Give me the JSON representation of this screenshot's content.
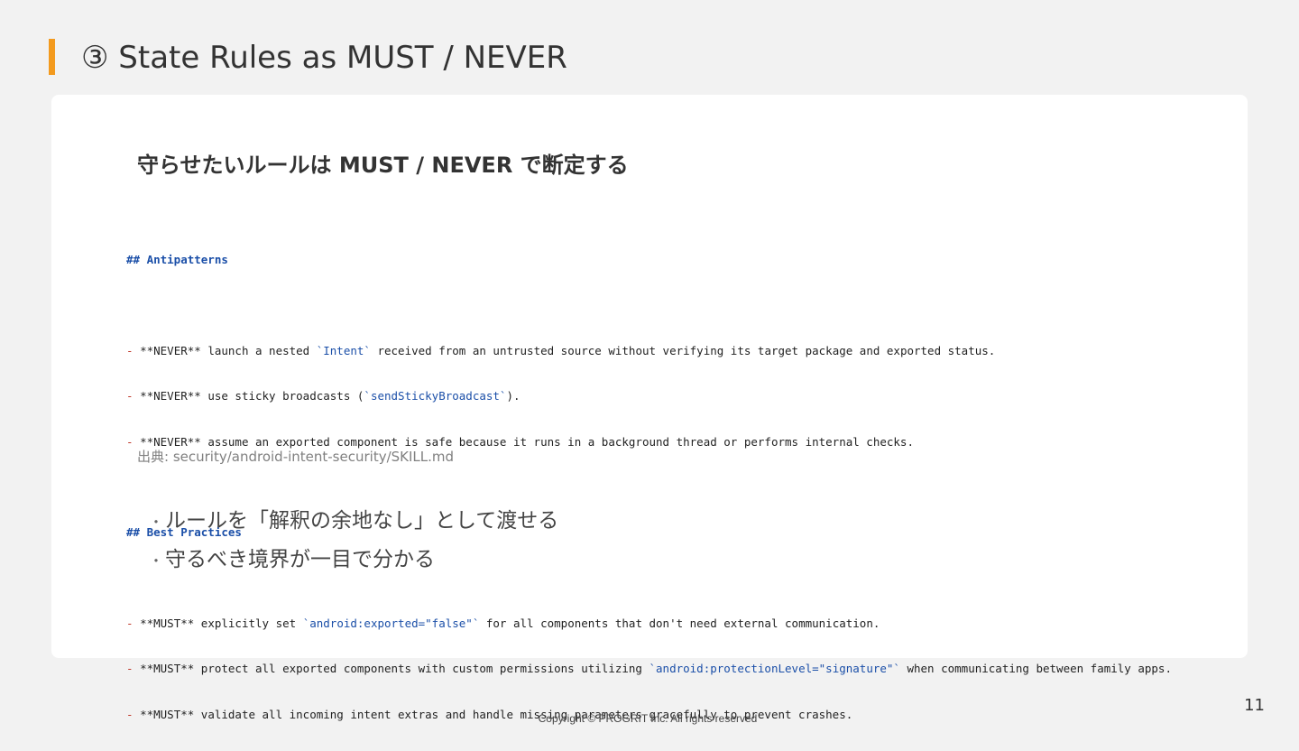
{
  "slide": {
    "title": "③ State Rules as MUST / NEVER",
    "accent_color": "#f39a1e"
  },
  "card": {
    "heading": "守らせたいルールは MUST / NEVER で断定する",
    "code": {
      "antipatterns_header": "## Antipatterns",
      "antipatterns": [
        {
          "dash": "- ",
          "pre": "**NEVER** launch a nested ",
          "code": "`Intent`",
          "post": " received from an untrusted source without verifying its target package and exported status."
        },
        {
          "dash": "- ",
          "pre": "**NEVER** use sticky broadcasts (",
          "code": "`sendStickyBroadcast`",
          "post": ")."
        },
        {
          "dash": "- ",
          "pre": "**NEVER** assume an exported component is safe because it runs in a background thread or performs internal checks.",
          "code": "",
          "post": ""
        }
      ],
      "best_practices_header": "## Best Practices",
      "best_practices": [
        {
          "dash": "- ",
          "pre": "**MUST** explicitly set ",
          "code": "`android:exported=\"false\"`",
          "post": " for all components that don't need external communication."
        },
        {
          "dash": "- ",
          "pre": "**MUST** protect all exported components with custom permissions utilizing ",
          "code": "`android:protectionLevel=\"signature\"`",
          "post": " when communicating between family apps."
        },
        {
          "dash": "- ",
          "pre": "**MUST** validate all incoming intent extras and handle missing parameters gracefully to prevent crashes.",
          "code": "",
          "post": ""
        }
      ]
    },
    "source": "出典: security/android-intent-security/SKILL.md",
    "bullets": [
      {
        "dot": "・",
        "text": "ルールを「解釈の余地なし」として渡せる"
      },
      {
        "dot": "・",
        "text": "守るべき境界が一目で分かる"
      }
    ]
  },
  "footer": {
    "page_number": "11",
    "copyright": "Copyright © PROGRIT Inc. All rights reserved"
  }
}
